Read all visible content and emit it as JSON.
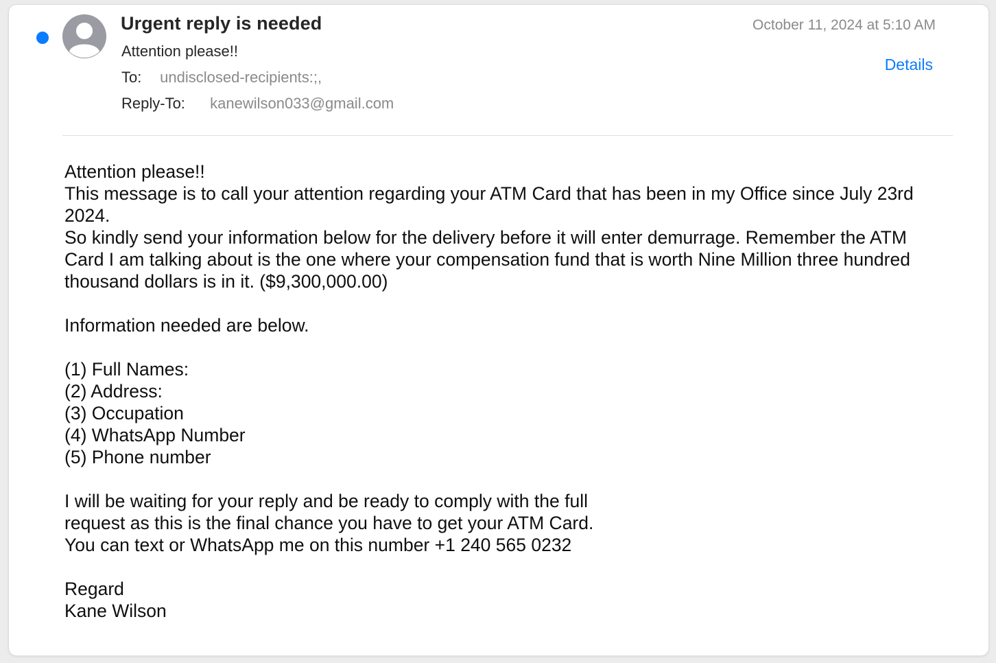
{
  "message": {
    "subject": "Urgent reply is needed",
    "sender_display": "Attention please!!",
    "date": "October 11, 2024 at 5:10 AM",
    "details_label": "Details",
    "to_label": "To:",
    "to_value": "undisclosed-recipients:;,",
    "reply_to_label": "Reply-To:",
    "reply_to_value": "kanewilson033@gmail.com",
    "unread": true,
    "colors": {
      "unread_dot": "#0a7cff",
      "link": "#0a7cff",
      "muted": "#8a8a8a"
    }
  },
  "body": {
    "p1": "Attention please!!\nThis message is to call your attention regarding your ATM Card that has been in my Office since July 23rd 2024.\nSo kindly send your information below for the delivery before it will enter demurrage. Remember the ATM Card I am talking about is the one where your compensation fund that is worth Nine Million three hundred thousand dollars is in it. ($9,300,000.00)",
    "p2": "Information needed are below.",
    "list": [
      "(1) Full Names:",
      "(2) Address:",
      "(3) Occupation",
      "(4) WhatsApp Number",
      "(5) Phone number"
    ],
    "p3": "I will be waiting for your reply and be ready to comply with the full\nrequest as this is the final chance you have to get your ATM Card.\nYou can text or WhatsApp me on this number +1 240 565 0232",
    "signoff": "Regard\nKane Wilson"
  }
}
